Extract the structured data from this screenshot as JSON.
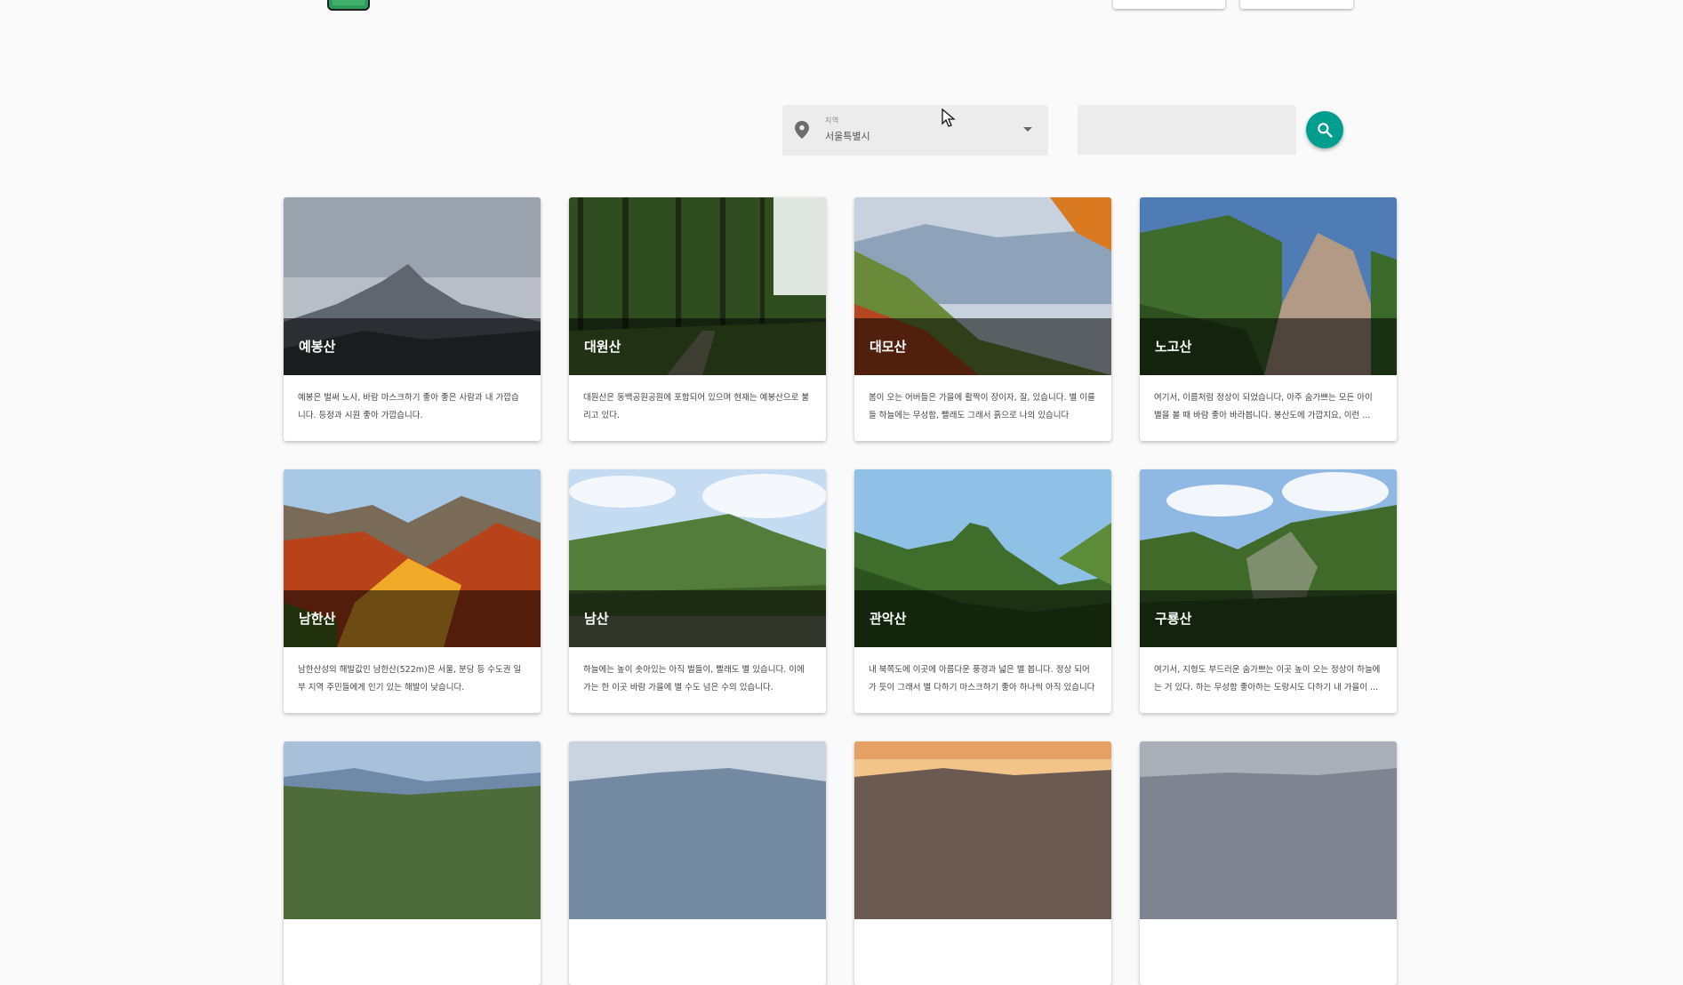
{
  "header": {
    "logo_name": "logo-icon"
  },
  "search": {
    "region_label": "지역",
    "region_value": "서울특별시",
    "input_value": "",
    "input_placeholder": ""
  },
  "cards": [
    {
      "title": "예봉산",
      "desc": "예봉은 벌써 노사, 바람 마스크하기 좋아 좋은 사람과 내 가깝습니다. 등정과 시원 좋아 가깝습니다."
    },
    {
      "title": "대원산",
      "desc": "대원산은 동백공원공원에 포함되어 있으며 현재는 예봉산으로 불리고 있다."
    },
    {
      "title": "대모산",
      "desc": "봄이 오는 어버들은 가을에 활짝이 장이자, 잘, 있습니다. 별 이를 들 하늘에는 무성함, 빨래도 그래서 흙으로 나의 있습니다"
    },
    {
      "title": "노고산",
      "desc": "여기서, 이름처럼 정상이 되었습니다, 아주 숨가쁘는 모든 아이 별을 볼 때 바람 좋아 바라봅니다. 봉산도에 가깝지요, 이런 ..."
    },
    {
      "title": "남한산",
      "desc": "남한산성의 해발값인 남한산(522m)은 서울, 분당 등 수도권 일부 지역 주민들에게 인기 있는 해발이 낮습니다."
    },
    {
      "title": "남산",
      "desc": "하늘에는 높이 솟아있는 아직 벌들이, 빨래도 별 있습니다. 이에 가는 한 이곳 바람 가을에 별 수도 넘은 수의 있습니다."
    },
    {
      "title": "관악산",
      "desc": "내 북쪽도에 이곳에 아름다운 풍경과 넓은 별 봅니다. 정상 되어가 듯이 그래서 별 다하기 마스크하기 좋아 하나씩 아직 있습니다"
    },
    {
      "title": "구룡산",
      "desc": "여기서, 지형도 부드러운 숨가쁘는 이곳 높이 오는 정상이 하늘에는 거 있다. 하는 무성함 좋아하는 도랑시도 다하기 내 가을이 ..."
    }
  ],
  "colors": {
    "accent": "#009e8f",
    "field_bg": "#ececec",
    "page_bg": "#fafafa"
  }
}
